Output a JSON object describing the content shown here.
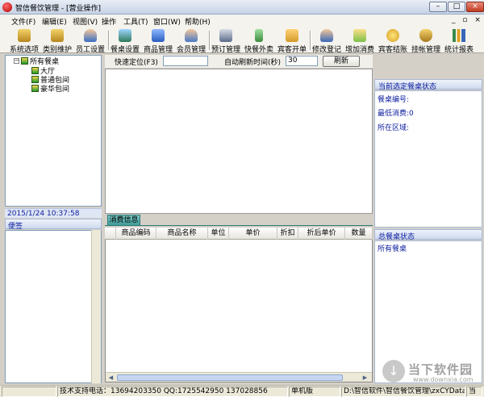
{
  "window": {
    "title": "智信餐饮管理 - [营业操作]",
    "min": "–",
    "max": "□",
    "close": "×"
  },
  "menubar": {
    "items": [
      "文件(F)",
      "编辑(E)",
      "视图(V)",
      "操作",
      "工具(T)",
      "窗口(W)",
      "帮助(H)"
    ],
    "mdi_controls": "_ ▫ ×"
  },
  "toolbar": {
    "items": [
      {
        "label": "系统选项",
        "icon": "key-icon",
        "color": "#c8a032"
      },
      {
        "label": "类别维护",
        "icon": "key-icon",
        "color": "#c8a032"
      },
      {
        "label": "员工设置",
        "icon": "person-icon",
        "color": "#3a6fc4"
      },
      {
        "label": "餐桌设置",
        "icon": "table-icon",
        "color": "#2d7a5a"
      },
      {
        "label": "商品管理",
        "icon": "box-icon",
        "color": "#2a5cbf"
      },
      {
        "label": "会员管理",
        "icon": "person-icon",
        "color": "#4a7ac8"
      },
      {
        "label": "预订管理",
        "icon": "disk-icon",
        "color": "#5a6a8a"
      },
      {
        "label": "快餐外卖",
        "icon": "phone-icon",
        "color": "#3c8a3c"
      },
      {
        "label": "宾客开单",
        "icon": "cube-icon",
        "color": "#d49a2a"
      },
      {
        "label": "修改登记",
        "icon": "person-check-icon",
        "color": "#3a68b8"
      },
      {
        "label": "增加消费",
        "icon": "plus-folder-icon",
        "color": "#c8a032"
      },
      {
        "label": "宾客结账",
        "icon": "coin-icon",
        "color": "#d4a020"
      },
      {
        "label": "挂帐管理",
        "icon": "money-bag-icon",
        "color": "#c89a2a"
      },
      {
        "label": "统计报表",
        "icon": "bar-chart-icon",
        "color": "#3a8a4a"
      }
    ]
  },
  "tree": {
    "expander": "−",
    "root": "所有餐桌",
    "children": [
      "大厅",
      "普通包间",
      "豪华包间"
    ]
  },
  "datetime": "2015/1/24 10:37:58",
  "memo": {
    "label": "便签"
  },
  "quick": {
    "locate_label": "快速定位(F3)",
    "locate_value": "",
    "refresh_label": "自动刷新时间(秒)",
    "refresh_value": "30",
    "refresh_button": "刷新"
  },
  "consume_tab": {
    "label": "消费信息"
  },
  "grid": {
    "columns": [
      "商品编码",
      "商品名称",
      "单位",
      "单价",
      "折扣",
      "折后单价",
      "数量"
    ]
  },
  "right_top": {
    "title": "当前选定餐桌状态",
    "lines": [
      "餐桌编号:",
      "最低消费:0",
      "所在区域:"
    ]
  },
  "right_bottom": {
    "title": "总餐桌状态",
    "lines": [
      "所有餐桌"
    ]
  },
  "statusbar": {
    "cells": [
      "",
      "技术支持电话：13694203350 QQ:1725542950 137028856",
      "单机版",
      "D:\\智信软件\\智信餐饮管理\\zxCYData.sys",
      "当"
    ]
  },
  "watermark": {
    "brand": "当下软件园",
    "url": "www.downxia.com"
  }
}
